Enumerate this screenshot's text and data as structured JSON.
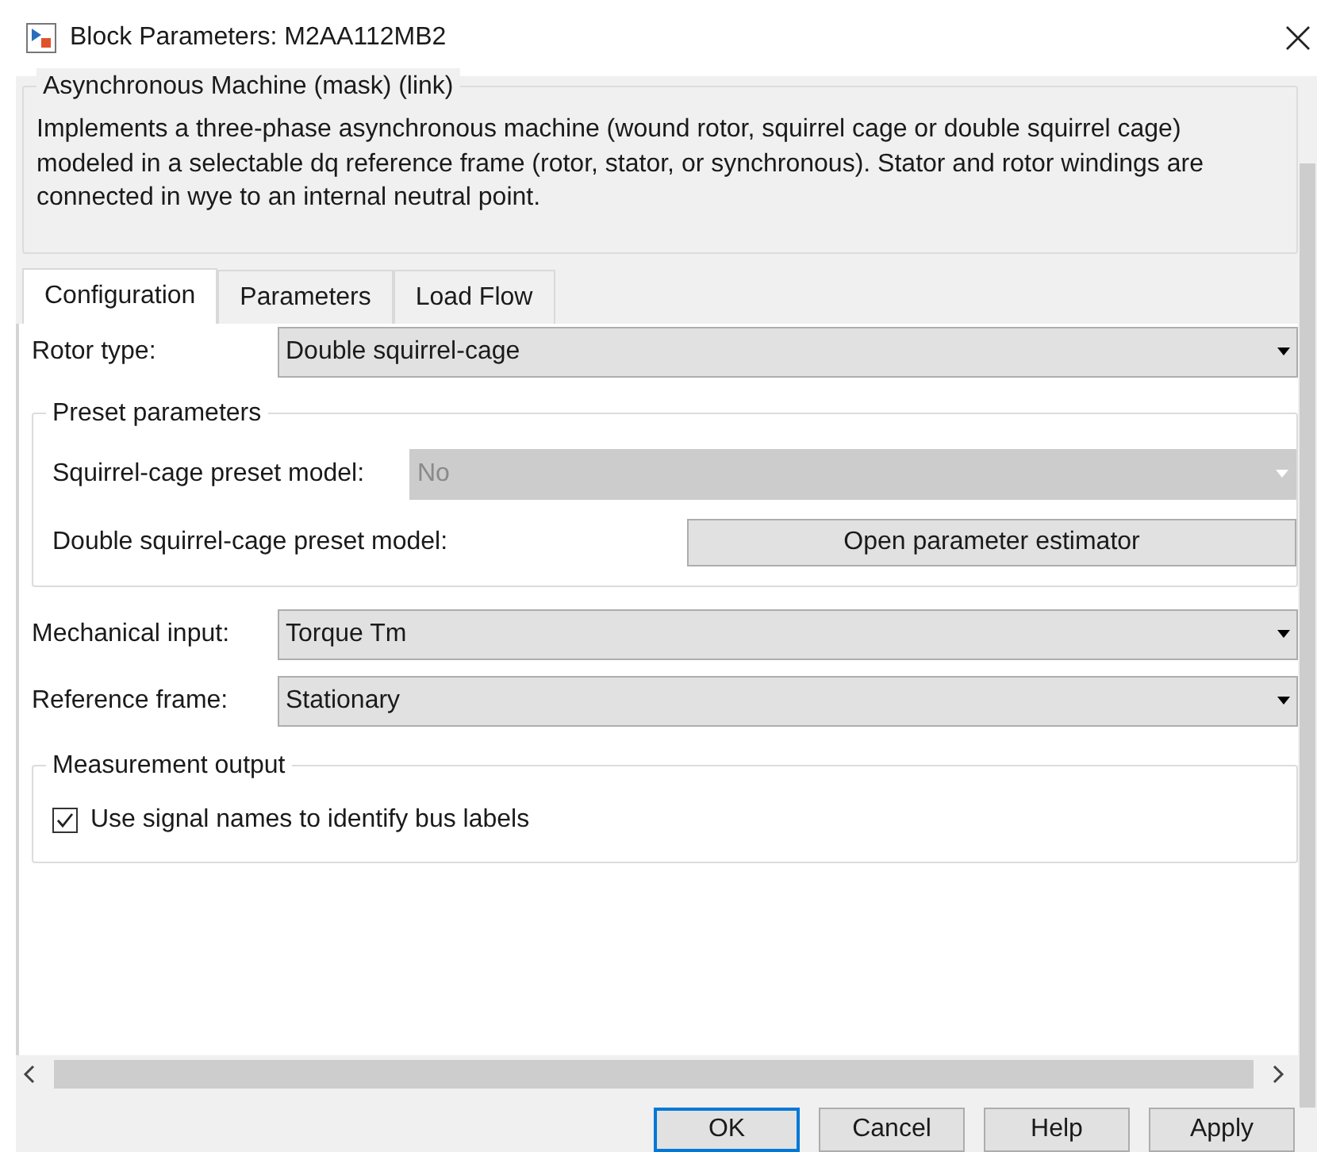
{
  "window": {
    "title": "Block Parameters: M2AA112MB2"
  },
  "header": {
    "title": "Asynchronous Machine (mask) (link)",
    "description": "Implements a three-phase asynchronous machine (wound rotor, squirrel cage or double squirrel cage) modeled in a selectable dq reference frame (rotor, stator, or synchronous). Stator and rotor windings are connected in wye to an internal neutral point."
  },
  "tabs": [
    {
      "label": "Configuration",
      "selected": true
    },
    {
      "label": "Parameters",
      "selected": false
    },
    {
      "label": "Load Flow",
      "selected": false
    }
  ],
  "rotor_type": {
    "label": "Rotor type:",
    "value": "Double squirrel-cage"
  },
  "preset": {
    "title": "Preset parameters",
    "items": [
      {
        "kind": "dropdown",
        "label": "Squirrel-cage preset model:",
        "value": "No",
        "disabled": true
      },
      {
        "kind": "button",
        "label": "Double squirrel-cage preset model:",
        "button": "Open parameter estimator"
      }
    ]
  },
  "mechanical_input": {
    "label": "Mechanical input:",
    "value": "Torque Tm"
  },
  "reference_frame": {
    "label": "Reference frame:",
    "value": "Stationary"
  },
  "measurement": {
    "title": "Measurement output",
    "checkbox": {
      "label": "Use signal names to identify bus labels",
      "checked": true
    }
  },
  "buttons": [
    {
      "label": "OK",
      "focused": true
    },
    {
      "label": "Cancel",
      "focused": false
    },
    {
      "label": "Help",
      "focused": false
    },
    {
      "label": "Apply",
      "focused": false
    }
  ]
}
